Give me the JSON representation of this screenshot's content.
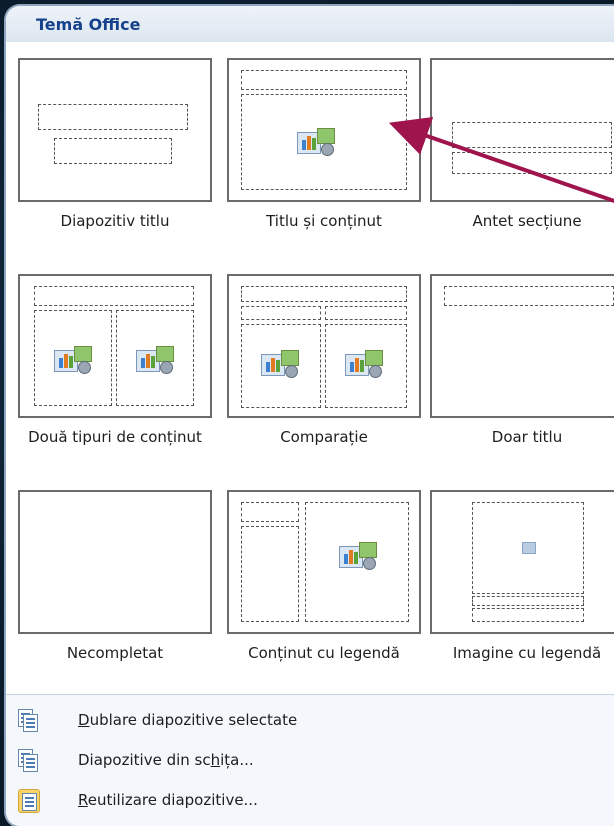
{
  "header": {
    "title": "Temă Office"
  },
  "layouts": [
    {
      "label": "Diapozitiv titlu"
    },
    {
      "label": "Titlu și conținut"
    },
    {
      "label": "Antet secțiune"
    },
    {
      "label": "Două tipuri de conținut"
    },
    {
      "label": "Comparație"
    },
    {
      "label": "Doar titlu"
    },
    {
      "label": "Necompletat"
    },
    {
      "label": "Conținut cu legendă"
    },
    {
      "label": "Imagine cu legendă"
    }
  ],
  "menu": [
    {
      "label": "Dublare diapozitive selectate",
      "accel": "D",
      "rest": "ublare diapozitive selectate",
      "icon": "duplicate-slides-icon"
    },
    {
      "label": "Diapozitive din schița...",
      "pre": "Diapozitive din sc",
      "accel": "h",
      "post": "ița...",
      "icon": "slides-from-outline-icon"
    },
    {
      "label": "Reutilizare diapozitive...",
      "accel": "R",
      "rest": "eutilizare diapozitive...",
      "icon": "reuse-slides-icon"
    }
  ],
  "colors": {
    "accent": "#15428b",
    "arrow": "#a0144e",
    "highlight": "#f9d469"
  }
}
